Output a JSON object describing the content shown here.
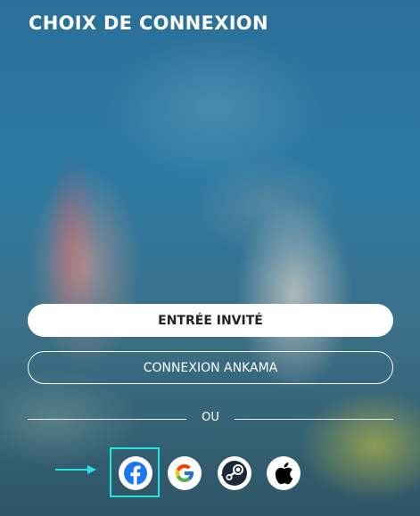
{
  "header": {
    "title": "CHOIX DE CONNEXION"
  },
  "buttons": {
    "guest_label": "ENTRÉE INVITÉ",
    "ankama_label": "CONNEXION ANKAMA"
  },
  "divider": {
    "label": "OU"
  },
  "social": [
    {
      "name": "facebook",
      "icon": "facebook-icon",
      "color": "#1877f2"
    },
    {
      "name": "google",
      "icon": "google-icon",
      "color": "#4285f4"
    },
    {
      "name": "steam",
      "icon": "steam-icon",
      "color": "#1b2838"
    },
    {
      "name": "apple",
      "icon": "apple-icon",
      "color": "#000000"
    }
  ],
  "annotation": {
    "highlight_color": "#22e6e6",
    "highlighted": "facebook"
  }
}
